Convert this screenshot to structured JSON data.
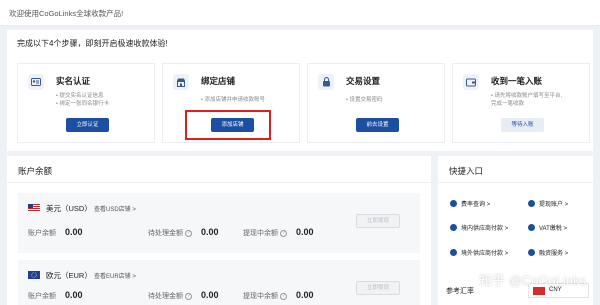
{
  "welcome": "欢迎使用CoGoLinks全球收款产品!",
  "steps": {
    "title": "完成以下4个步骤，即刻开启极速收款体验!",
    "cards": [
      {
        "name": "实名认证",
        "desc": [
          "• 提交实名认证信息",
          "• 绑定一张同名银行卡"
        ],
        "button": "立即认证",
        "icon": "id-card-icon"
      },
      {
        "name": "绑定店铺",
        "desc": [
          "• 添加店铺并申请收款账号"
        ],
        "button": "添加店铺",
        "icon": "store-icon"
      },
      {
        "name": "交易设置",
        "desc": [
          "• 设置交易密码"
        ],
        "button": "前去设置",
        "icon": "lock-icon"
      },
      {
        "name": "收到一笔入账",
        "desc": [
          "• 请先将收款账户填写至平台,",
          "  完成一笔收款"
        ],
        "button": "等待入账",
        "icon": "wallet-icon"
      }
    ]
  },
  "balance": {
    "title": "账户余额",
    "currencies": [
      {
        "name": "美元（USD）",
        "link": "查看USD店铺 >",
        "withdraw": "立即提现",
        "available_label": "账户余额",
        "available": "0.00",
        "pending_label": "待处理金额",
        "pending": "0.00",
        "withdrawing_label": "提现中余额",
        "withdrawing": "0.00",
        "flag": "us-flag"
      },
      {
        "name": "欧元（EUR）",
        "link": "查看EUR店铺 >",
        "withdraw": "立即提现",
        "available_label": "账户余额",
        "available": "0.00",
        "pending_label": "待处理金额",
        "pending": "0.00",
        "withdrawing_label": "提现中余额",
        "withdrawing": "0.00",
        "flag": "eu-flag"
      }
    ]
  },
  "quick": {
    "title": "快捷入口",
    "items": [
      {
        "label": "费率查询 >"
      },
      {
        "label": "提现账户 >"
      },
      {
        "label": "境内供应商付款 >"
      },
      {
        "label": "VAT缴税 >"
      },
      {
        "label": "境外供应商付款 >"
      },
      {
        "label": "融资服务 >"
      }
    ],
    "ref_label": "参考汇率",
    "currency": "CNY"
  },
  "watermark": "知乎 @CoGoLinks",
  "colors": {
    "accent": "#1a4fa1",
    "highlight": "#e11d1d"
  }
}
